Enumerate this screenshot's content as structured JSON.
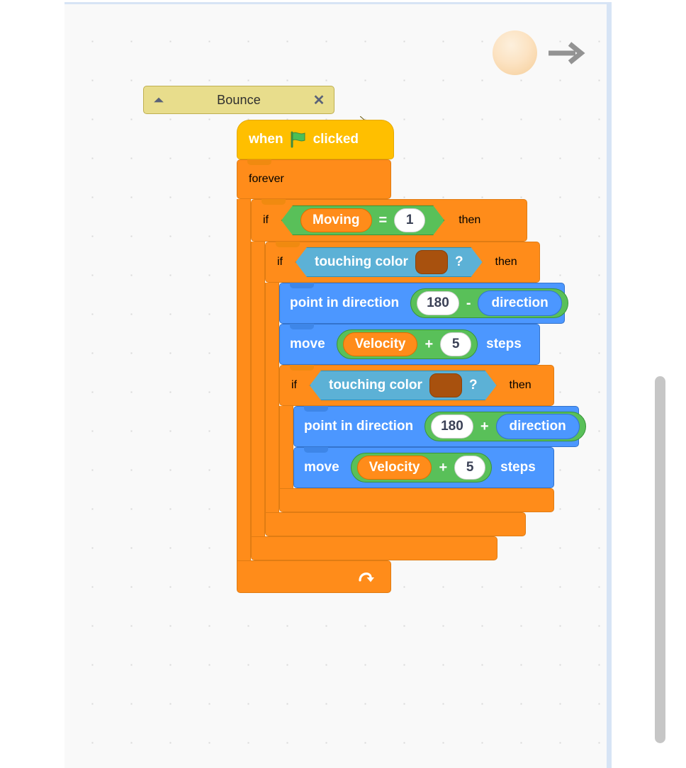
{
  "workspace": {
    "background_color": "#f9f9f9",
    "border_color": "#d7e4f5",
    "grid_dot_color": "#d9d9d9"
  },
  "sprite_preview": {
    "ball_name": "ball-sprite",
    "ball_color": "#fce3c3",
    "arrow_name": "direction-arrow-icon",
    "arrow_color": "#939393"
  },
  "scrollbar": {
    "name": "vertical-scrollbar",
    "thumb_color": "#c6c6c6"
  },
  "comment": {
    "title": "Bounce",
    "collapse_glyph": "▲",
    "close_glyph": "✕",
    "background": "#e8dd8c",
    "border": "#bfaf51"
  },
  "script": {
    "hat": {
      "when_label": "when",
      "flag_icon": "green-flag-icon",
      "clicked_label": "clicked",
      "color": "#ffbf00"
    },
    "forever": {
      "label": "forever",
      "loop_icon": "loop-arrow-icon",
      "color": "#ff8c1a"
    },
    "if_outer": {
      "if_label": "if",
      "then_label": "then",
      "condition": {
        "operator": "=",
        "left_variable": "Moving",
        "right_value": "1",
        "operator_color": "#59c059",
        "variable_color": "#ff8c1a"
      }
    },
    "if_first": {
      "if_label": "if",
      "then_label": "then",
      "condition": {
        "label": "touching color",
        "question_mark": "?",
        "color_value": "#a8510e",
        "block_color": "#5cb1d6"
      },
      "statements": [
        {
          "name": "point-in-direction-block",
          "label": "point in direction",
          "operand_left": "180",
          "operator": "-",
          "operand_right": "direction",
          "color": "#4c97ff"
        },
        {
          "name": "move-steps-block",
          "label_prefix": "move",
          "label_suffix": "steps",
          "operand_left": "Velocity",
          "operator": "+",
          "operand_right": "5",
          "color": "#4c97ff"
        }
      ]
    },
    "if_second": {
      "if_label": "if",
      "then_label": "then",
      "condition": {
        "label": "touching color",
        "question_mark": "?",
        "color_value": "#a8510e",
        "block_color": "#5cb1d6"
      },
      "statements": [
        {
          "name": "point-in-direction-block",
          "label": "point in direction",
          "operand_left": "180",
          "operator": "+",
          "operand_right": "direction",
          "color": "#4c97ff"
        },
        {
          "name": "move-steps-block",
          "label_prefix": "move",
          "label_suffix": "steps",
          "operand_left": "Velocity",
          "operator": "+",
          "operand_right": "5",
          "color": "#4c97ff"
        }
      ]
    }
  }
}
